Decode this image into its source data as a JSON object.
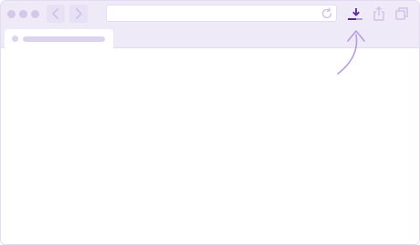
{
  "window": {
    "control_dots": [
      "window-close-dot",
      "window-minimize-dot",
      "window-maximize-dot"
    ]
  },
  "toolbar": {
    "back_icon": "chevron-left-icon",
    "forward_icon": "chevron-right-icon",
    "reload_icon": "reload-icon",
    "download_icon": "download-icon",
    "share_icon": "share-icon",
    "tabs_icon": "tabs-icon"
  },
  "url_bar": {
    "value": "",
    "placeholder": ""
  },
  "tabs": [
    {
      "title": ""
    }
  ],
  "colors": {
    "chrome": "#eeeaf8",
    "accent": "#5a2a9a",
    "arrow": "#b99ce0",
    "icon_muted": "#cfc3e6"
  }
}
